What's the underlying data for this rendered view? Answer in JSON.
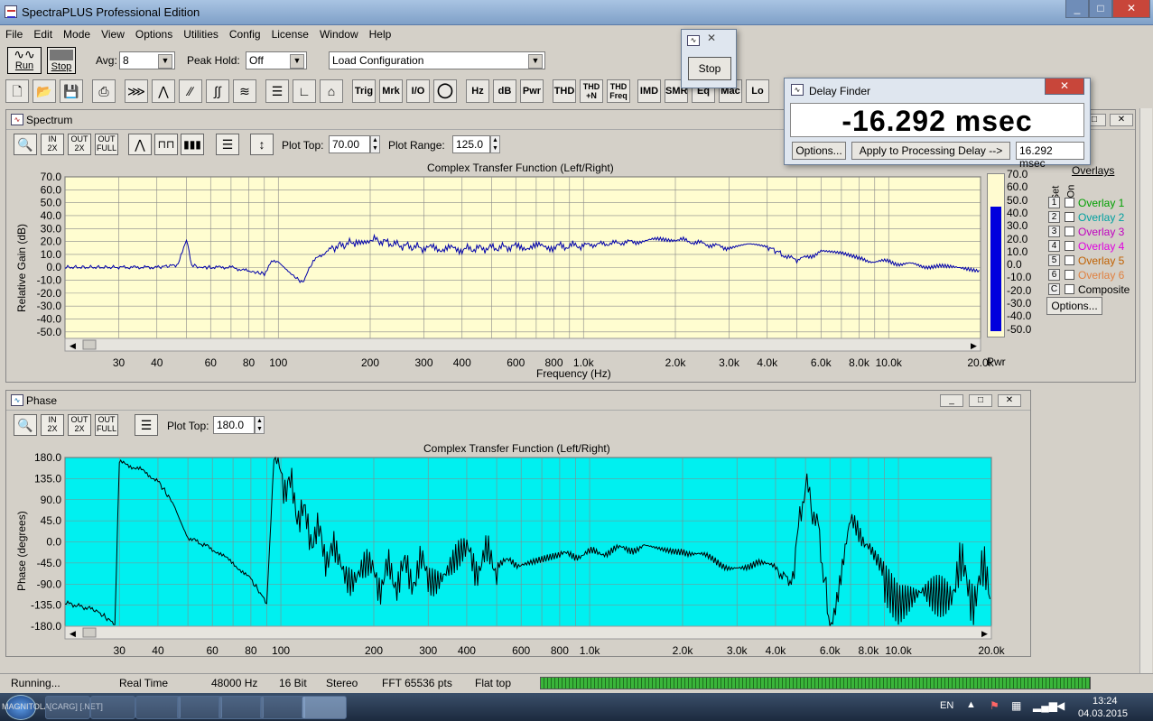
{
  "window": {
    "title": "SpectraPLUS Professional Edition"
  },
  "menu": [
    "File",
    "Edit",
    "Mode",
    "View",
    "Options",
    "Utilities",
    "Config",
    "License",
    "Window",
    "Help"
  ],
  "toolbar": {
    "run": "Run",
    "stop": "Stop",
    "avg_label": "Avg:",
    "avg_value": "8",
    "peak_label": "Peak Hold:",
    "peak_value": "Off",
    "config_value": "Load Configuration"
  },
  "tools": [
    "Trig",
    "Mrk",
    "I/O",
    "Hz",
    "dB",
    "Pwr",
    "THD",
    "THD +N",
    "THD Freq",
    "IMD",
    "SMR",
    "Eq",
    "Mac",
    "Lo"
  ],
  "stop_dialog": {
    "button": "Stop"
  },
  "delay_finder": {
    "title": "Delay Finder",
    "reading": "-16.292 msec",
    "options": "Options...",
    "apply": "Apply to Processing Delay -->",
    "value": "16.292 msec"
  },
  "spectrum": {
    "title": "Spectrum",
    "plot_top_label": "Plot Top:",
    "plot_top": "70.00",
    "plot_range_label": "Plot Range:",
    "plot_range": "125.0",
    "chart_title": "Complex Transfer Function (Left/Right)",
    "ylabel": "Relative Gain (dB)",
    "xlabel": "Frequency (Hz)",
    "yticks": [
      "70.0",
      "60.0",
      "50.0",
      "40.0",
      "30.0",
      "20.0",
      "10.0",
      "0.0",
      "-10.0",
      "-20.0",
      "-30.0",
      "-40.0",
      "-50.0"
    ],
    "xticks": [
      "30",
      "40",
      "60",
      "80",
      "100",
      "200",
      "300",
      "400",
      "600",
      "800",
      "1.0k",
      "2.0k",
      "3.0k",
      "4.0k",
      "6.0k",
      "8.0k",
      "10.0k",
      "20.0k"
    ],
    "pwr_label": "Pwr",
    "pwr_level": 0.82
  },
  "overlays": {
    "header": "Overlays",
    "set": "Set",
    "on": "On",
    "items": [
      {
        "n": "1",
        "label": "Overlay 1",
        "color": "#00a000"
      },
      {
        "n": "2",
        "label": "Overlay 2",
        "color": "#00a0a0"
      },
      {
        "n": "3",
        "label": "Overlay 3",
        "color": "#c000c0"
      },
      {
        "n": "4",
        "label": "Overlay 4",
        "color": "#e000e0"
      },
      {
        "n": "5",
        "label": "Overlay 5",
        "color": "#c06000"
      },
      {
        "n": "6",
        "label": "Overlay 6",
        "color": "#e08040"
      },
      {
        "n": "C",
        "label": "Composite",
        "color": "#000000"
      }
    ],
    "options": "Options..."
  },
  "phase": {
    "title": "Phase",
    "plot_top_label": "Plot Top:",
    "plot_top": "180.0",
    "chart_title": "Complex Transfer Function (Left/Right)",
    "ylabel": "Phase (degrees)",
    "yticks": [
      "180.0",
      "135.0",
      "90.0",
      "45.0",
      "0.0",
      "-45.0",
      "-90.0",
      "-135.0",
      "-180.0"
    ]
  },
  "status": {
    "state": "Running...",
    "mode": "Real Time",
    "rate": "48000 Hz",
    "bits": "16 Bit",
    "channels": "Stereo",
    "fft": "FFT 65536 pts",
    "window": "Flat top"
  },
  "taskbar": {
    "lang": "EN",
    "time": "13:24",
    "date": "04.03.2015",
    "label": "MAGNITOLA[CARG] [.NET]"
  },
  "chart_data": [
    {
      "type": "line",
      "title": "Complex Transfer Function (Left/Right)",
      "xlabel": "Frequency (Hz)",
      "ylabel": "Relative Gain (dB)",
      "xscale": "log",
      "xlim": [
        20,
        20000
      ],
      "ylim": [
        -55,
        70
      ],
      "grid": true,
      "series": [
        {
          "x": [
            20,
            30,
            40,
            47,
            50,
            52,
            55,
            60,
            70,
            80,
            90,
            95,
            100,
            110,
            120,
            130,
            150,
            180,
            200,
            250,
            300,
            400,
            500,
            600,
            800,
            1000,
            1500,
            2000,
            2500,
            3000,
            3500,
            4000,
            4500,
            5000,
            6000,
            7000,
            8000,
            10000,
            12000,
            15000,
            20000
          ],
          "y": [
            0,
            0,
            0,
            2,
            22,
            2,
            0,
            0,
            0,
            -3,
            -5,
            4,
            5,
            -5,
            -12,
            5,
            15,
            20,
            22,
            17,
            15,
            14,
            15,
            16,
            16,
            17,
            20,
            22,
            18,
            15,
            17,
            16,
            10,
            5,
            12,
            10,
            6,
            4,
            2,
            0,
            -2
          ]
        }
      ]
    },
    {
      "type": "line",
      "title": "Complex Transfer Function (Left/Right)",
      "ylabel": "Phase (degrees)",
      "xscale": "log",
      "xlim": [
        20,
        20000
      ],
      "ylim": [
        -180,
        180
      ],
      "grid": true,
      "series": [
        {
          "x": [
            20,
            25,
            29,
            30,
            35,
            40,
            45,
            50,
            60,
            70,
            80,
            90,
            95,
            100,
            120,
            150,
            200,
            300,
            400,
            600,
            800,
            1000,
            1500,
            2000,
            2500,
            3000,
            3500,
            4000,
            4500,
            5000,
            5500,
            6000,
            7000,
            8000,
            10000,
            12000,
            15000,
            20000
          ],
          "y": [
            -130,
            -145,
            -175,
            170,
            155,
            130,
            80,
            10,
            -15,
            -45,
            -80,
            -130,
            175,
            150,
            40,
            -40,
            -80,
            -60,
            -40,
            -45,
            -30,
            -25,
            -10,
            -15,
            -40,
            -55,
            -40,
            -60,
            -85,
            130,
            20,
            -175,
            30,
            10,
            -90,
            -60,
            -80,
            -100
          ]
        }
      ]
    }
  ]
}
